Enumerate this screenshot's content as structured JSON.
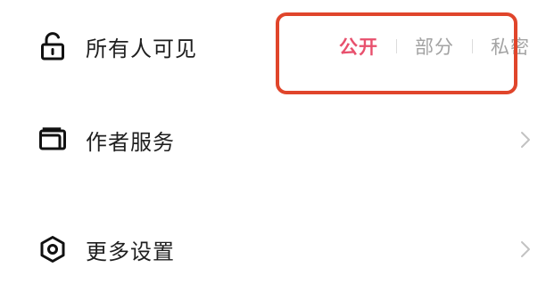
{
  "settings": {
    "visibility": {
      "label": "所有人可见",
      "icon": "unlocked-padlock-icon",
      "options": [
        "公开",
        "部分",
        "私密"
      ],
      "selected": "公开",
      "accent_color": "#e8506d"
    },
    "author_services": {
      "label": "作者服务",
      "icon": "wallet-icon"
    },
    "more_settings": {
      "label": "更多设置",
      "icon": "hexagon-settings-icon"
    }
  },
  "annotation": {
    "highlight_color": "#e0452b"
  }
}
